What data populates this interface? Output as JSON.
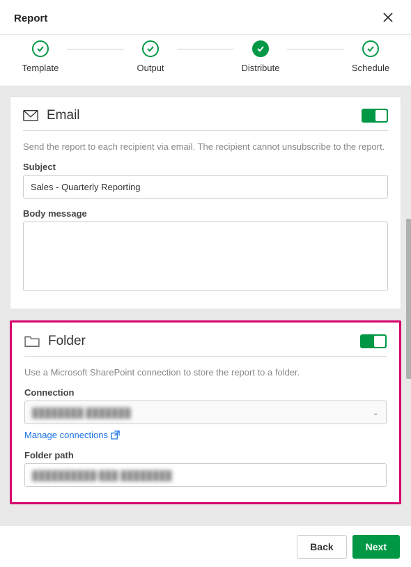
{
  "header": {
    "title": "Report"
  },
  "steps": [
    {
      "label": "Template",
      "filled": false
    },
    {
      "label": "Output",
      "filled": false
    },
    {
      "label": "Distribute",
      "filled": true
    },
    {
      "label": "Schedule",
      "filled": false
    }
  ],
  "email": {
    "title": "Email",
    "helper": "Send the report to each recipient via email. The recipient cannot unsubscribe to the report.",
    "subject_label": "Subject",
    "subject_value": "Sales - Quarterly Reporting",
    "body_label": "Body message",
    "body_value": ""
  },
  "folder": {
    "title": "Folder",
    "helper": "Use a Microsoft SharePoint connection to store the report to a folder.",
    "connection_label": "Connection",
    "connection_value": "████████ ███████",
    "manage_link": "Manage connections",
    "path_label": "Folder path",
    "path_value": "██████████/███ ████████"
  },
  "footer": {
    "back": "Back",
    "next": "Next"
  }
}
